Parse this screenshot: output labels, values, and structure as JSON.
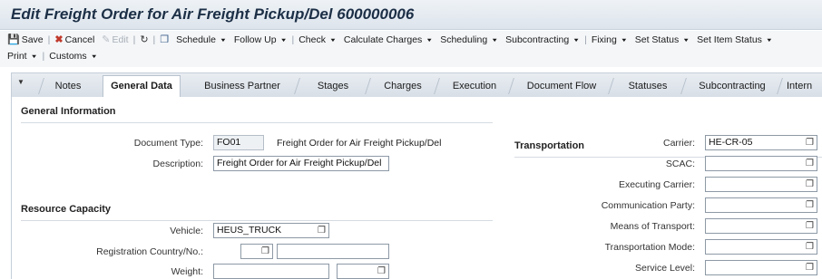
{
  "title": "Edit Freight Order for Air Freight Pickup/Del 600000006",
  "toolbar": {
    "save": "Save",
    "cancel": "Cancel",
    "edit": "Edit",
    "schedule": "Schedule",
    "follow_up": "Follow Up",
    "check": "Check",
    "calculate_charges": "Calculate Charges",
    "scheduling": "Scheduling",
    "subcontracting": "Subcontracting",
    "fixing": "Fixing",
    "set_status": "Set Status",
    "set_item_status": "Set Item Status",
    "print": "Print",
    "customs": "Customs"
  },
  "tabs": [
    {
      "label": "Notes"
    },
    {
      "label": "General Data"
    },
    {
      "label": "Business Partner"
    },
    {
      "label": "Stages"
    },
    {
      "label": "Charges"
    },
    {
      "label": "Execution"
    },
    {
      "label": "Document Flow"
    },
    {
      "label": "Statuses"
    },
    {
      "label": "Subcontracting"
    },
    {
      "label": "Intern"
    }
  ],
  "general_info": {
    "title": "General Information",
    "doc_type_label": "Document Type:",
    "doc_type_value": "FO01",
    "doc_type_desc": "Freight Order for Air Freight Pickup/Del",
    "description_label": "Description:",
    "description_value": "Freight Order for Air Freight Pickup/Del"
  },
  "resource": {
    "title": "Resource Capacity",
    "vehicle_label": "Vehicle:",
    "vehicle_value": "HEUS_TRUCK",
    "registration_label": "Registration Country/No.:",
    "registration_country": "",
    "registration_no": "",
    "weight_label": "Weight:",
    "weight_value": "",
    "weight_unit": ""
  },
  "transportation": {
    "title": "Transportation",
    "carrier_label": "Carrier:",
    "carrier_value": "HE-CR-05",
    "scac_label": "SCAC:",
    "scac_value": "",
    "exec_carrier_label": "Executing Carrier:",
    "exec_carrier_value": "",
    "comm_party_label": "Communication Party:",
    "comm_party_value": "",
    "means_label": "Means of Transport:",
    "means_value": "",
    "mode_label": "Transportation Mode:",
    "mode_value": "",
    "service_label": "Service Level:",
    "service_value": ""
  },
  "icons": {
    "value_help": "value-help-icon",
    "save": "save-icon",
    "cancel": "cancel-icon",
    "edit": "edit-icon",
    "refresh": "refresh-icon",
    "copy": "copy-icon",
    "tab_menu": "tab-menu-icon"
  },
  "colors": {
    "title_text": "#1c2f46",
    "cancel_icon": "#c0392b",
    "field_border": "#8d99a6"
  }
}
